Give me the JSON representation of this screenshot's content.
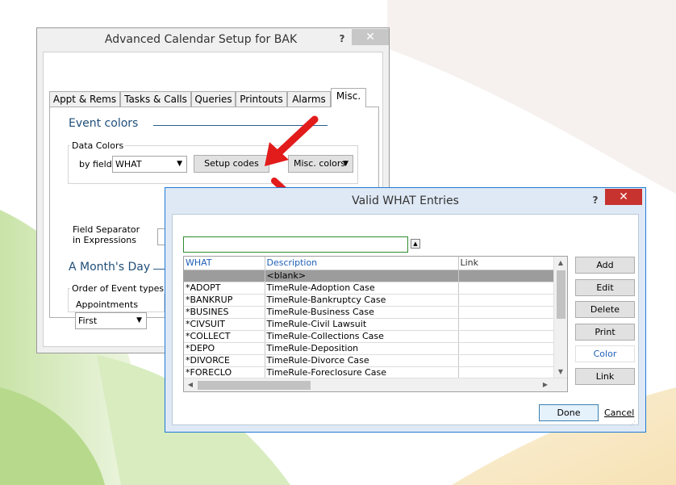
{
  "back_window": {
    "title": "Advanced Calendar Setup for BAK",
    "help": "?",
    "close": "✕",
    "tabs": [
      {
        "label": "Appt & Rems"
      },
      {
        "label": "Tasks & Calls"
      },
      {
        "label": "Queries"
      },
      {
        "label": "Printouts"
      },
      {
        "label": "Alarms"
      },
      {
        "label": "Misc."
      }
    ],
    "event_colors": {
      "heading": "Event colors",
      "group_label": "Data Colors",
      "by_field_label": "by field",
      "by_field_value": "WHAT",
      "setup_codes": "Setup codes",
      "misc_colors": "Misc. colors"
    },
    "field_separator_label": "Field Separator in Expressions",
    "months_day": {
      "heading": "A Month's Day",
      "group_label": "Order of Event types",
      "appointments_label": "Appointments",
      "appointments_value": "First"
    }
  },
  "front_window": {
    "title": "Valid WHAT Entries",
    "help": "?",
    "close": "✕",
    "search_value": "",
    "columns": [
      "WHAT",
      "Description",
      "Link"
    ],
    "rows": [
      {
        "what": "",
        "description": "<blank>",
        "link": ""
      },
      {
        "what": "*ADOPT",
        "description": "TimeRule-Adoption Case",
        "link": ""
      },
      {
        "what": "*BANKRUP",
        "description": "TimeRule-Bankruptcy Case",
        "link": ""
      },
      {
        "what": "*BUSINES",
        "description": "TimeRule-Business Case",
        "link": ""
      },
      {
        "what": "*CIVSUIT",
        "description": "TimeRule-Civil Lawsuit",
        "link": ""
      },
      {
        "what": "*COLLECT",
        "description": "TimeRule-Collections Case",
        "link": ""
      },
      {
        "what": "*DEPO",
        "description": "TimeRule-Deposition",
        "link": ""
      },
      {
        "what": "*DIVORCE",
        "description": "TimeRule-Divorce Case",
        "link": ""
      },
      {
        "what": "*FORECLO",
        "description": "TimeRule-Foreclosure Case",
        "link": ""
      }
    ],
    "buttons": {
      "add": "Add",
      "edit": "Edit",
      "delete": "Delete",
      "print": "Print",
      "color": "Color",
      "link": "Link",
      "done": "Done",
      "cancel": "Cancel"
    }
  },
  "colors": {
    "close_red": "#c7332f",
    "annotation_arrow": "#e21b1b",
    "header_blue": "#1f5fb8",
    "selected_row": "#9c9c9c"
  },
  "icons": {
    "collapse": "up-arrow-icon",
    "dropdown": "chevron-down-icon"
  }
}
